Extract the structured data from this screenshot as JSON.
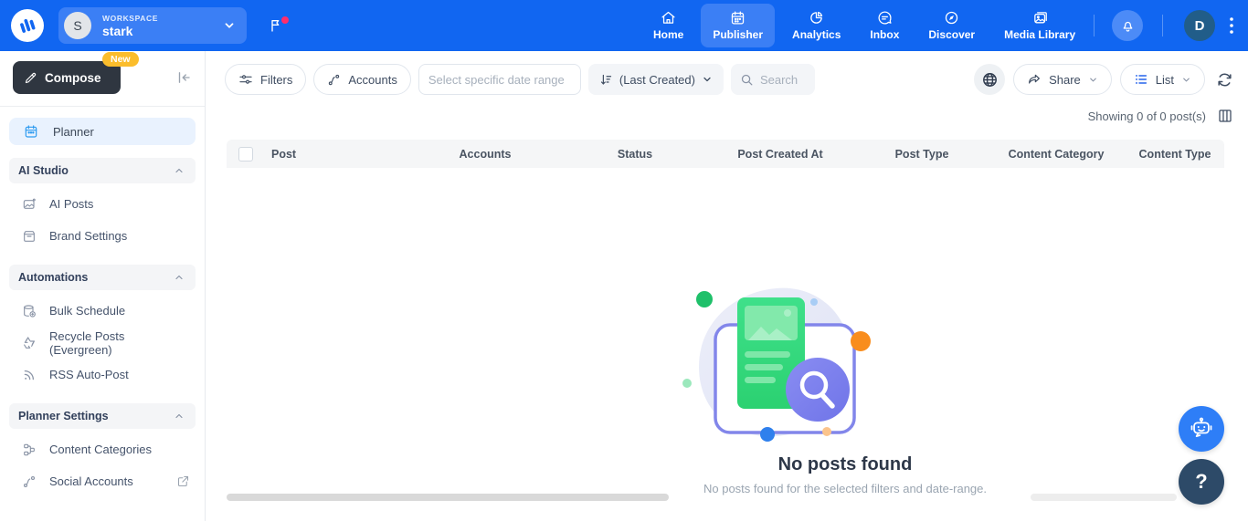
{
  "header": {
    "workspace": {
      "label": "WORKSPACE",
      "name": "stark",
      "initial": "S"
    },
    "nav": [
      {
        "label": "Home"
      },
      {
        "label": "Publisher"
      },
      {
        "label": "Analytics"
      },
      {
        "label": "Inbox"
      },
      {
        "label": "Discover"
      },
      {
        "label": "Media Library"
      }
    ],
    "active_nav": "Publisher",
    "profile_initial": "D"
  },
  "sidebar": {
    "compose": {
      "label": "Compose",
      "badge": "New"
    },
    "planner": {
      "label": "Planner"
    },
    "sections": [
      {
        "title": "AI Studio",
        "items": [
          {
            "label": "AI Posts"
          },
          {
            "label": "Brand Settings"
          }
        ]
      },
      {
        "title": "Automations",
        "items": [
          {
            "label": "Bulk Schedule"
          },
          {
            "label": "Recycle Posts (Evergreen)"
          },
          {
            "label": "RSS Auto-Post"
          }
        ]
      },
      {
        "title": "Planner Settings",
        "items": [
          {
            "label": "Content Categories"
          },
          {
            "label": "Social Accounts"
          }
        ]
      }
    ]
  },
  "toolbar": {
    "filters": "Filters",
    "accounts": "Accounts",
    "date_placeholder": "Select specific date range",
    "sort": "(Last Created)",
    "search_placeholder": "Search",
    "share": "Share",
    "view": "List"
  },
  "content": {
    "showing": "Showing 0 of 0 post(s)",
    "table_headers": [
      "Post",
      "Accounts",
      "Status",
      "Post Created At",
      "Post Type",
      "Content Category",
      "Content Type"
    ],
    "empty": {
      "title": "No posts found",
      "subtitle": "No posts found for the selected filters and date-range."
    },
    "help_label": "?"
  },
  "colors": {
    "navbar": "#1166f1",
    "navbar_active": "#3b7ff5",
    "notification_dot": "#ff2d6c",
    "compose_bg": "#2f3640",
    "badge_bg": "#fbbd2c",
    "planner_active_bg": "#e9f2fe",
    "accent_blue": "#2e7ef7",
    "help_bg": "#2d4a68",
    "illustration_green": "#35d978",
    "illustration_purple": "#7d82ee",
    "illustration_orange": "#f97316"
  }
}
